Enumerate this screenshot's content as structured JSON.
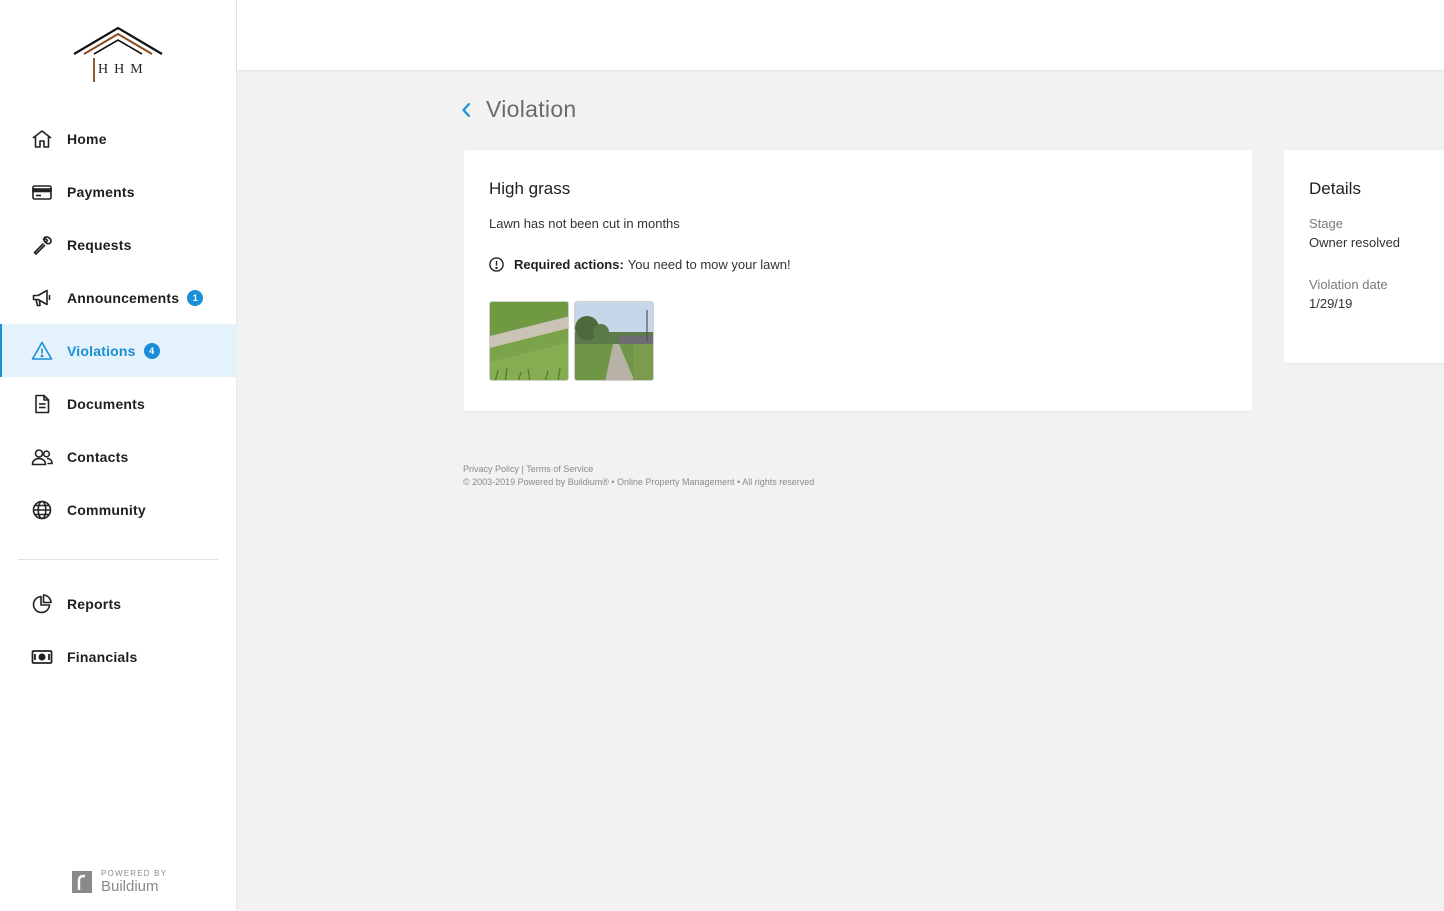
{
  "brand": {
    "logo_letters": "HHM",
    "powered_small": "POWERED BY",
    "powered_brand": "Buildium"
  },
  "sidebar": {
    "items": [
      {
        "label": "Home",
        "icon": "home-icon"
      },
      {
        "label": "Payments",
        "icon": "credit-card-icon"
      },
      {
        "label": "Requests",
        "icon": "wrench-icon"
      },
      {
        "label": "Announcements",
        "icon": "megaphone-icon",
        "badge": "1"
      },
      {
        "label": "Violations",
        "icon": "warning-icon",
        "badge": "4",
        "active": true
      },
      {
        "label": "Documents",
        "icon": "document-icon"
      },
      {
        "label": "Contacts",
        "icon": "people-icon"
      },
      {
        "label": "Community",
        "icon": "globe-icon"
      }
    ],
    "secondary": [
      {
        "label": "Reports",
        "icon": "pie-chart-icon"
      },
      {
        "label": "Financials",
        "icon": "money-icon"
      }
    ]
  },
  "page": {
    "title": "Violation"
  },
  "violation": {
    "title": "High grass",
    "description": "Lawn has not been cut in months",
    "required_label": "Required actions:",
    "required_text": "You need to mow your lawn!"
  },
  "details": {
    "title": "Details",
    "stage_label": "Stage",
    "stage_value": "Owner resolved",
    "date_label": "Violation date",
    "date_value": "1/29/19"
  },
  "footer": {
    "privacy": "Privacy Policy",
    "separator": "|",
    "terms": "Terms of Service",
    "copyright": "© 2003-2019 Powered by Buildium® • Online Property Management • All rights reserved"
  },
  "colors": {
    "accent": "#1a8fd6",
    "active_bg": "#e4f2fb"
  }
}
